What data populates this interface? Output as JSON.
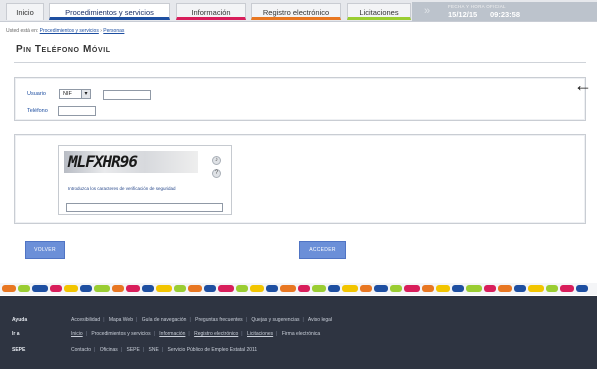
{
  "tabs": [
    {
      "label": "Inicio"
    },
    {
      "label": "Procedimientos y servicios"
    },
    {
      "label": "Información"
    },
    {
      "label": "Registro electrónico"
    },
    {
      "label": "Licitaciones"
    }
  ],
  "clock": {
    "label": "FECHA Y HORA OFICIAL",
    "date": "15/12/15",
    "time": "09:23:58"
  },
  "breadcrumb": {
    "prefix": "Usted está en:",
    "items": [
      "Procedimientos y servicios",
      "Personas"
    ]
  },
  "page": {
    "title": "Pin Teléfono Móvil"
  },
  "form": {
    "user_label": "Usuario",
    "id_type": "NIF",
    "phone_label": "Teléfono"
  },
  "captcha": {
    "text": "MLFXHR96",
    "hint": "Introduzca los caracteres de verificación de seguridad"
  },
  "buttons": {
    "back": "VOLVER",
    "enter": "ACCEDER"
  },
  "footer": {
    "rows": [
      {
        "head": "Ayuda",
        "links": [
          "Accesibilidad",
          "Mapa Web",
          "Guía de navegación",
          "Preguntas frecuentes",
          "Quejas y sugerencias",
          "Aviso legal"
        ]
      },
      {
        "head": "Ir a",
        "links": [
          "Inicio",
          "Procedimientos y servicios",
          "Información",
          "Registro electrónico",
          "Licitaciones",
          "Firma electrónica"
        ]
      },
      {
        "head": "SEPE",
        "links": [
          "Contacto",
          "Oficinas",
          "SEPE",
          "SNE",
          "Servicio Público de Empleo Estatal 2011"
        ]
      }
    ]
  },
  "colors": {
    "accent": "#1e4fa1",
    "footer_bg": "#2e3441",
    "button": "#6b8fd8"
  }
}
